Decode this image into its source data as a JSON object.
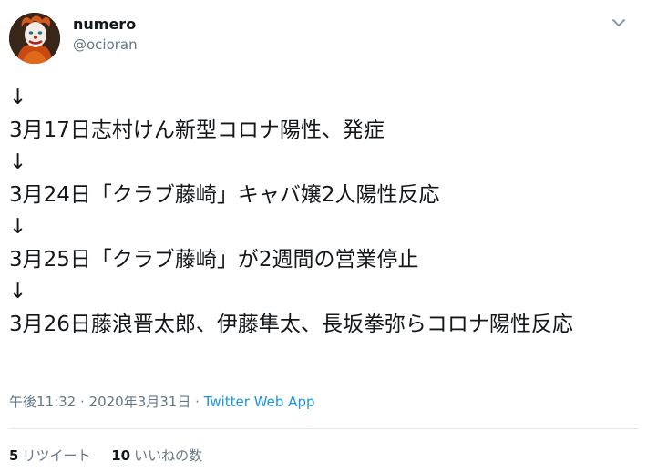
{
  "author": {
    "name": "numero",
    "handle": "@ocioran"
  },
  "tweet": {
    "lines": [
      "↓",
      "3月17日志村けん新型コロナ陽性、発症",
      "↓",
      "3月24日「クラブ藤崎」キャバ嬢2人陽性反応",
      "↓",
      "3月25日「クラブ藤崎」が2週間の営業停止",
      "↓",
      "3月26日藤浪晋太郎、伊藤隼太、長坂拳弥らコロナ陽性反応"
    ]
  },
  "meta": {
    "time": "午後11:32",
    "sep1": " · ",
    "date": "2020年3月31日",
    "sep2": " · ",
    "source": "Twitter Web App"
  },
  "stats": {
    "retweets_count": "5",
    "retweets_label": "リツイート",
    "likes_count": "10",
    "likes_label": "いいねの数"
  },
  "colors": {
    "text": "#14171a",
    "secondary": "#657786",
    "link": "#1b95e0",
    "divider": "#e1e8ed"
  }
}
